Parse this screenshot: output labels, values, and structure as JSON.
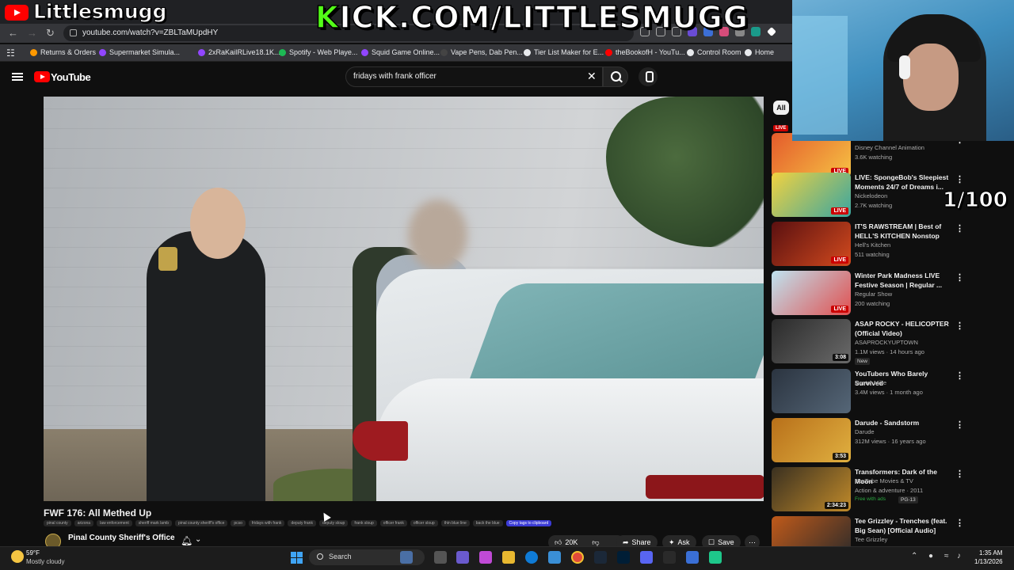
{
  "overlay": {
    "channel_name": "Littlesmugg",
    "kick_k": "K",
    "kick_rest": "ICK.COM/LITTLESMUGG",
    "counter": "1/100"
  },
  "browser": {
    "url": "youtube.com/watch?v=ZBLTaMUpdHY",
    "bookmarks": [
      {
        "label": "Returns & Orders",
        "color": "#ff9900"
      },
      {
        "label": "Supermarket Simula...",
        "color": "#9146ff"
      },
      {
        "label": "2xRaKaiIRLive18.1K...",
        "color": "#9146ff"
      },
      {
        "label": "Spotify - Web Playe...",
        "color": "#1db954"
      },
      {
        "label": "Squid Game Online...",
        "color": "#9146ff"
      },
      {
        "label": "Vape Pens, Dab Pen...",
        "color": "#444444"
      },
      {
        "label": "Tier List Maker for E...",
        "color": "#e8eaed"
      },
      {
        "label": "theBookofH - YouTu...",
        "color": "#ff0000"
      },
      {
        "label": "Control Room",
        "color": "#e8eaed"
      },
      {
        "label": "Home",
        "color": "#e8eaed"
      }
    ]
  },
  "youtube": {
    "logo_text": "YouTube",
    "search_value": "fridays with frank officer",
    "filter_chip": "All"
  },
  "video": {
    "title": "FWF 176: All Methed Up",
    "tags": [
      "pinal county",
      "arizona",
      "law enforcement",
      "sheriff mark lamb",
      "pinal county sheriff's office",
      "pcso",
      "fridays with frank",
      "deputy frank",
      "deputy sloup",
      "frank sloup",
      "officer frank",
      "officer sloup",
      "thin blue line",
      "back the blue"
    ],
    "copy_tags_label": "Copy tags to clipboard",
    "channel": "Pinal County Sheriff's Office",
    "likes": "20K",
    "share_label": "Share",
    "ask_label": "Ask",
    "save_label": "Save"
  },
  "recommendations": [
    {
      "title": "",
      "channel": "Disney Channel Animation",
      "meta": "3.6K watching",
      "badge": "LIVE",
      "thumb": [
        "#e45a2b",
        "#f6c244"
      ]
    },
    {
      "title": "LIVE: SpongeBob's Sleepiest Moments 24/7 of Dreams i...",
      "channel": "Nickelodeon",
      "meta": "2.7K watching",
      "badge": "LIVE",
      "thumb": [
        "#f2d240",
        "#3aa6a0"
      ]
    },
    {
      "title": "IT'S RAWSTREAM | Best of HELL'S KITCHEN Nonstop",
      "channel": "Hell's Kitchen",
      "meta": "511 watching",
      "badge": "LIVE",
      "thumb": [
        "#5a1010",
        "#d24a1e"
      ]
    },
    {
      "title": "Winter Park Madness LIVE Festive Season | Regular ...",
      "channel": "Regular Show",
      "meta": "200 watching",
      "badge": "LIVE",
      "thumb": [
        "#bfe3f0",
        "#e05050"
      ]
    },
    {
      "title": "ASAP ROCKY - HELICOPTER (Official Video)",
      "channel": "ASAPROCKYUPTOWN",
      "meta": "1.1M views · 14 hours ago",
      "extra": "New",
      "badge": "3:08",
      "thumb": [
        "#2a2a2a",
        "#6a6a6a"
      ]
    },
    {
      "title": "YouTubers Who Barely Survived",
      "channel": "Doctor Mike",
      "meta": "3.4M views · 1 month ago",
      "badge": "",
      "thumb": [
        "#2b3440",
        "#556677"
      ]
    },
    {
      "title": "Darude - Sandstorm",
      "channel": "Darude",
      "meta": "312M views · 16 years ago",
      "badge": "3:53",
      "thumb": [
        "#b8701a",
        "#e0b040"
      ]
    },
    {
      "title": "Transformers: Dark of the Moon",
      "channel": "YouTube Movies & TV",
      "meta": "Action & adventure · 2011",
      "extra": "Free with ads",
      "extra2": "PG-13",
      "badge": "2:34:23",
      "thumb": [
        "#3a3020",
        "#c08a2a"
      ]
    },
    {
      "title": "Tee Grizzley - Trenches (feat. Big Sean) [Official Audio]",
      "channel": "Tee Grizzley",
      "meta": "",
      "badge": "",
      "thumb": [
        "#c05a1a",
        "#2a2a2a"
      ]
    }
  ],
  "taskbar": {
    "temp": "59°F",
    "weather": "Mostly cloudy",
    "search_label": "Search",
    "time": "1:35 AM",
    "date": "1/13/2026"
  }
}
